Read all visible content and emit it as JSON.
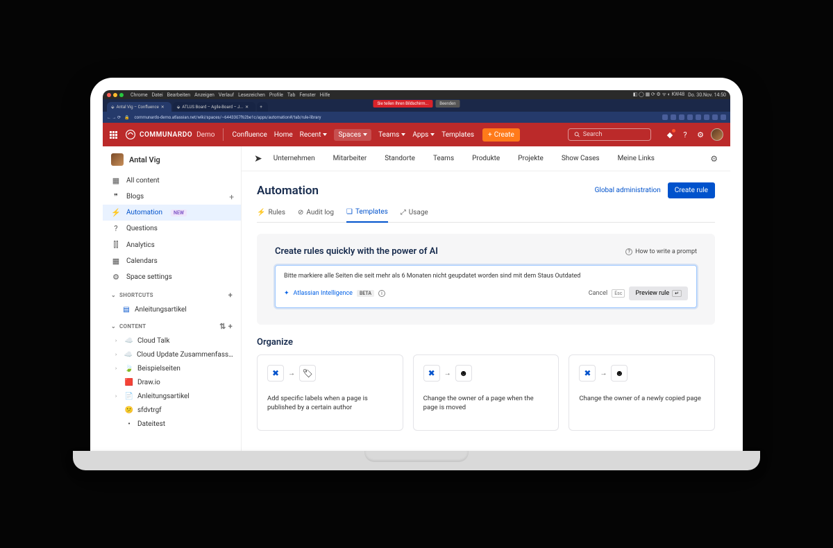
{
  "mac_menubar": {
    "left": [
      "Chrome",
      "Datei",
      "Bearbeiten",
      "Anzeigen",
      "Verlauf",
      "Lesezeichen",
      "Profile",
      "Tab",
      "Fenster",
      "Hilfe"
    ],
    "right_time": "Do. 30.Nov.   14:50"
  },
  "chrome": {
    "tab1": "Antal Vig – Confluence",
    "tab2": "ATLUS Board – Agile-Board – J...",
    "screen_share": "Sie teilen Ihren Bildschirm...",
    "stop_share": "Beenden",
    "url": "communardo-demo.atlassian.net/wiki/spaces/~6443307f62be1c/apps/automation#/tab/rule-library"
  },
  "header": {
    "logo": "COMMUNARDO",
    "logo_suffix": "Demo",
    "nav": [
      "Confluence",
      "Home",
      "Recent",
      "Spaces",
      "Teams",
      "Apps",
      "Templates"
    ],
    "create": "Create",
    "search_placeholder": "Search"
  },
  "sidebar": {
    "user_name": "Antal Vig",
    "items": [
      {
        "icon": "grid",
        "label": "All content"
      },
      {
        "icon": "quote",
        "label": "Blogs",
        "plus": true
      },
      {
        "icon": "bolt",
        "label": "Automation",
        "pill": "NEW",
        "active": true
      },
      {
        "icon": "question",
        "label": "Questions"
      },
      {
        "icon": "chart",
        "label": "Analytics"
      },
      {
        "icon": "calendar",
        "label": "Calendars"
      },
      {
        "icon": "gear",
        "label": "Space settings"
      }
    ],
    "shortcuts_label": "SHORTCUTS",
    "shortcuts": [
      {
        "icon": "📄",
        "label": "Anleitungsartikel"
      }
    ],
    "content_label": "CONTENT",
    "content": [
      {
        "icon": "☁️",
        "label": "Cloud Talk"
      },
      {
        "icon": "☁️",
        "label": "Cloud Update Zusammenfassungen"
      },
      {
        "icon": "🍃",
        "label": "Beispielseiten"
      },
      {
        "icon": "🟥",
        "label": "Draw.io"
      },
      {
        "icon": "📄",
        "label": "Anleitungsartikel"
      },
      {
        "icon": "😕",
        "label": "sfdvtrgf"
      },
      {
        "icon": "•",
        "label": "Dateitest"
      }
    ]
  },
  "space_nav": [
    "Unternehmen",
    "Mitarbeiter",
    "Standorte",
    "Teams",
    "Produkte",
    "Projekte",
    "Show Cases",
    "Meine Links"
  ],
  "page": {
    "title": "Automation",
    "global_admin": "Global administration",
    "create_rule": "Create rule"
  },
  "tabs": [
    {
      "icon": "⚡",
      "label": "Rules"
    },
    {
      "icon": "⊘",
      "label": "Audit log"
    },
    {
      "icon": "📋",
      "label": "Templates",
      "active": true
    },
    {
      "icon": "📈",
      "label": "Usage"
    }
  ],
  "ai": {
    "heading": "Create rules quickly with the power of AI",
    "how_prompt": "How to write a prompt",
    "prompt_text": "Bitte markiere alle Seiten die seit mehr als 6 Monaten nicht geupdatet worden sind mit dem Staus Outdated",
    "brand": "Atlassian Intelligence",
    "beta": "BETA",
    "cancel": "Cancel",
    "esc": "Esc",
    "preview": "Preview rule"
  },
  "organize": {
    "heading": "Organize",
    "cards": [
      {
        "to": "tag",
        "desc": "Add specific labels when a page is published by a certain author"
      },
      {
        "to": "person",
        "desc": "Change the owner of a page when the page is moved"
      },
      {
        "to": "person",
        "desc": "Change the owner of a newly copied page"
      }
    ]
  }
}
